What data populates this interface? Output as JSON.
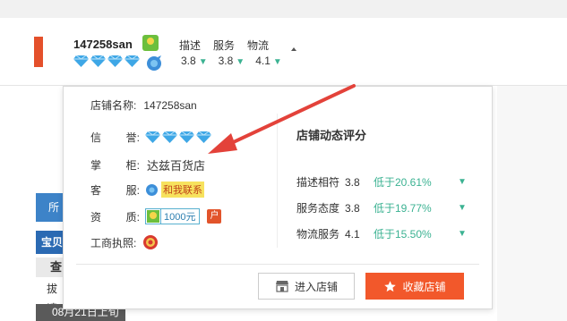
{
  "header": {
    "shop_name": "147258san",
    "rating_labels": [
      "描述",
      "服务",
      "物流"
    ],
    "rating_values": [
      "3.8",
      "3.8",
      "4.1"
    ]
  },
  "background": {
    "blue_tab": "所",
    "bao_tab": "宝贝",
    "cha_tab": "查",
    "jiao_tab": "拔请",
    "date_strip": "08月21日上旬"
  },
  "popup": {
    "shop_name_label": "店铺名称:",
    "shop_name_value": "147258san",
    "credit_label_a": "信",
    "credit_label_b": "誉:",
    "owner_label_a": "掌",
    "owner_label_b": "柜:",
    "owner_value": "达兹百货店",
    "service_label_a": "客",
    "service_label_b": "服:",
    "contact_text": "和我联系",
    "qual_label_a": "资",
    "qual_label_b": "质:",
    "deposit_amount": "1000元",
    "hu_badge": "户",
    "license_label": "工商执照:",
    "dynamic_title": "店铺动态评分",
    "dynamic_rows": [
      {
        "name": "描述相符",
        "score": "3.8",
        "cmp": "低于20.61%"
      },
      {
        "name": "服务态度",
        "score": "3.8",
        "cmp": "低于19.77%"
      },
      {
        "name": "物流服务",
        "score": "4.1",
        "cmp": "低于15.50%"
      }
    ],
    "enter_button": "进入店铺",
    "fav_button": "收藏店铺"
  },
  "colors": {
    "accent_orange": "#f2582b",
    "trend_green": "#3bb292",
    "diamond_blue": "#3ea7e6",
    "annotation_red": "#e3423a"
  }
}
